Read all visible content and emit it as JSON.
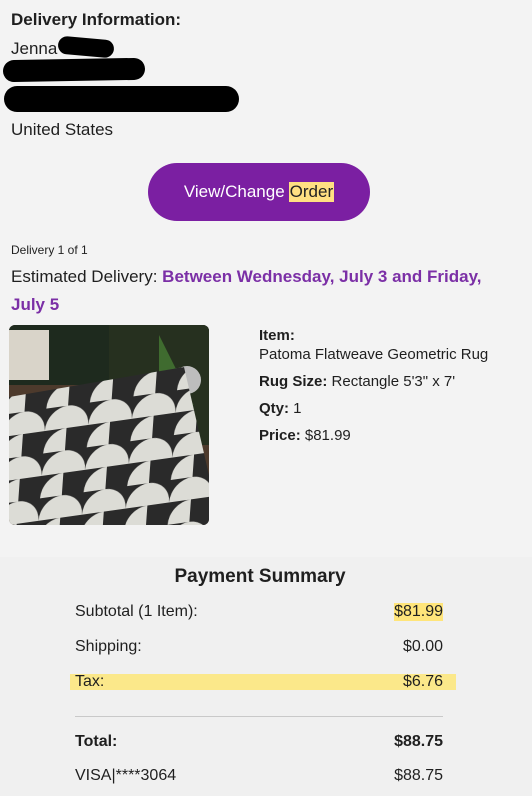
{
  "delivery": {
    "heading": "Delivery Information:",
    "name_visible": "Jenna",
    "country": "United States"
  },
  "button": {
    "label_part1": "View/Change",
    "label_part2": "Order"
  },
  "shipment": {
    "count_label": "Delivery 1 of 1",
    "estimated_label": "Estimated Delivery:",
    "estimated_value": "Between Wednesday, July 3 and Friday, July 5"
  },
  "product": {
    "item_label": "Item:",
    "item_name": "Patoma Flatweave Geometric Rug",
    "size_label": "Rug Size:",
    "size_value": "Rectangle 5'3\" x 7'",
    "qty_label": "Qty:",
    "qty_value": "1",
    "price_label": "Price:",
    "price_value": "$81.99"
  },
  "payment": {
    "title": "Payment Summary",
    "subtotal_label": "Subtotal (1 Item):",
    "subtotal_value": "$81.99",
    "shipping_label": "Shipping:",
    "shipping_value": "$0.00",
    "tax_label": "Tax:",
    "tax_value": "$6.76",
    "total_label": "Total:",
    "total_value": "$88.75",
    "card_label": "VISA|****3064",
    "card_value": "$88.75"
  },
  "colors": {
    "accent": "#7b1fa2",
    "highlight": "#ffe57a"
  }
}
